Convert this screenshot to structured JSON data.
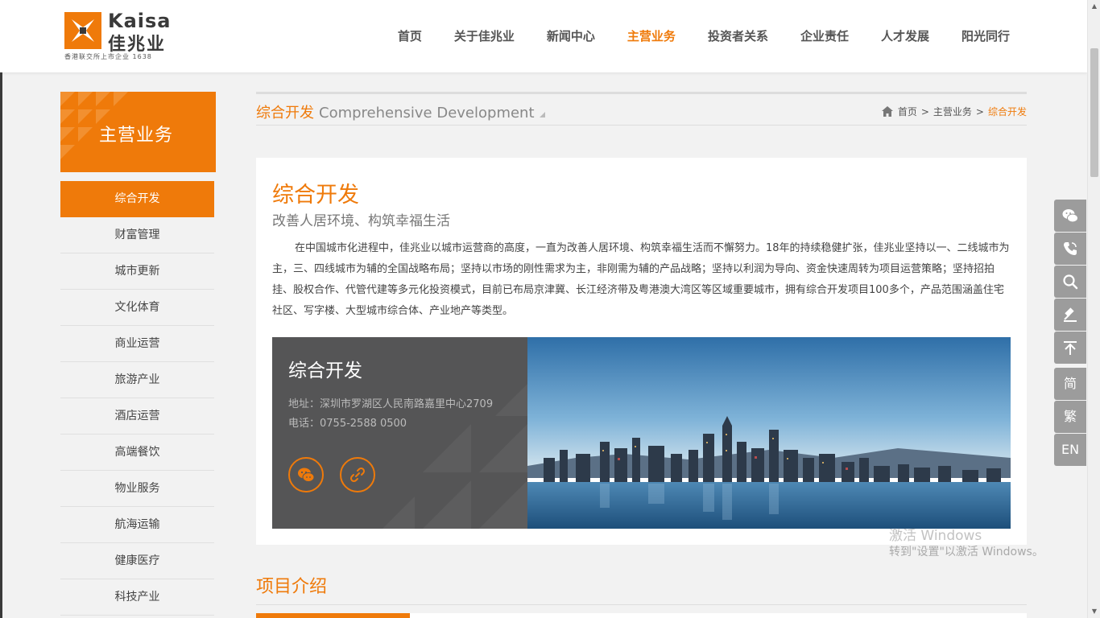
{
  "colors": {
    "accent": "#ef7a0a",
    "panel": "#555556",
    "tool": "#9c9c9c"
  },
  "logo": {
    "en": "Kaisa",
    "cn": "佳兆业",
    "sub": "香港联交所上市企业 1638"
  },
  "nav": {
    "items": [
      "首页",
      "关于佳兆业",
      "新闻中心",
      "主营业务",
      "投资者关系",
      "企业责任",
      "人才发展",
      "阳光同行"
    ],
    "active_index": 3
  },
  "sidebar": {
    "title": "主营业务",
    "items": [
      "综合开发",
      "财富管理",
      "城市更新",
      "文化体育",
      "商业运营",
      "旅游产业",
      "酒店运营",
      "高端餐饮",
      "物业服务",
      "航海运输",
      "健康医疗",
      "科技产业"
    ],
    "active_index": 0
  },
  "page_header": {
    "title_cn": "综合开发",
    "title_en": "Comprehensive Development"
  },
  "breadcrumb": {
    "home": "首页",
    "sep1": ">",
    "section": "主营业务",
    "sep2": ">",
    "current": "综合开发"
  },
  "content": {
    "title": "综合开发",
    "subtitle": "改善人居环境、构筑幸福生活",
    "body": "在中国城市化进程中，佳兆业以城市运营商的高度，一直为改善人居环境、构筑幸福生活而不懈努力。18年的持续稳健扩张，佳兆业坚持以一、二线城市为主，三、四线城市为辅的全国战略布局；坚持以市场的刚性需求为主，非刚需为辅的产品战略；坚持以利润为导向、资金快速周转为项目运营策略；坚持招拍挂、股权合作、代管代建等多元化投资模式，目前已布局京津冀、长江经济带及粤港澳大湾区等区域重要城市，拥有综合开发项目100多个，产品范围涵盖住宅社区、写字楼、大型城市综合体、产业地产等类型。"
  },
  "feature": {
    "name": "综合开发",
    "address": "地址：深圳市罗湖区人民南路嘉里中心2709",
    "phone": "电话：0755-2588 0500",
    "buttons": [
      "wechat-icon",
      "link-icon"
    ]
  },
  "section": {
    "title": "项目介绍"
  },
  "tools": {
    "icons": [
      "wechat-icon",
      "phone-icon",
      "search-icon",
      "auction-icon",
      "back-to-top-icon"
    ],
    "lang": [
      "简",
      "繁",
      "EN"
    ]
  },
  "watermark": {
    "line1": "激活 Windows",
    "line2": "转到\"设置\"以激活 Windows。"
  }
}
